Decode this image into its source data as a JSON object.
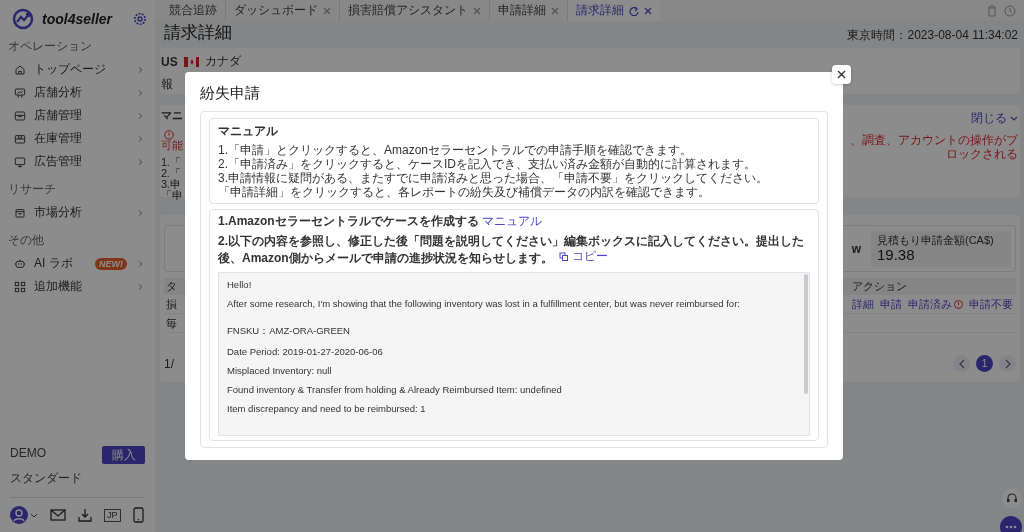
{
  "sidebar": {
    "brand": "tool4seller",
    "sections": [
      {
        "title": "オペレーション",
        "items": [
          {
            "label": "トップページ"
          },
          {
            "label": "店舗分析"
          },
          {
            "label": "店舗管理"
          },
          {
            "label": "在庫管理"
          },
          {
            "label": "広告管理"
          }
        ]
      },
      {
        "title": "リサーチ",
        "items": [
          {
            "label": "市場分析"
          }
        ]
      },
      {
        "title": "その他",
        "items": [
          {
            "label": "AI ラボ",
            "badge": "NEW!"
          },
          {
            "label": "追加機能"
          }
        ]
      }
    ],
    "account": {
      "name": "DEMO",
      "plan": "スタンダード",
      "buy_button": "購入",
      "language": "JP"
    }
  },
  "tabs": [
    {
      "label": "競合追跡",
      "selected": false,
      "closable": false
    },
    {
      "label": "ダッシュボード",
      "selected": false,
      "closable": true
    },
    {
      "label": "損害賠償アシスタント",
      "selected": false,
      "closable": true
    },
    {
      "label": "申請詳細",
      "selected": false,
      "closable": true
    },
    {
      "label": "請求詳細",
      "selected": true,
      "closable": true
    }
  ],
  "page": {
    "title": "請求詳細",
    "time": "東京時間：2023-08-04 11:34:02",
    "marketplace": {
      "code": "US",
      "country": "カナダ",
      "label_fragment": "報"
    },
    "manual_panel": {
      "title_fragment": "マニ",
      "collapse": "閉じる",
      "warning_fragment": "可能",
      "warning_right": "、調査、アカウントの操作がブロックされる",
      "line_fragments": [
        "1.「",
        "2.「",
        "3.申",
        "「申"
      ]
    },
    "summary": {
      "stat_fragment": "w",
      "estimate_label": "見積もり申請金額(CA$)",
      "estimate_value": "19.38"
    },
    "table": {
      "header_fragment": "タ",
      "action_header": "アクション",
      "row_fragments": [
        "損",
        "毎"
      ],
      "actions": [
        {
          "label": "詳細",
          "info": false
        },
        {
          "label": "申請",
          "info": false
        },
        {
          "label": "申請済み",
          "info": true
        },
        {
          "label": "申請不要",
          "info": false
        }
      ]
    },
    "pagination": {
      "total_fragment": "1/",
      "pages": [
        {
          "label": "1",
          "selected": true
        }
      ]
    }
  },
  "modal": {
    "title": "紛失申請",
    "manual": {
      "title": "マニュアル",
      "lines": [
        "1.「申請」とクリックすると、Amazonセラーセントラルでの申請手順を確認できます。",
        "2.「申請済み」をクリックすると、ケースIDを記入でき、支払い済み金額が自動的に計算されます。",
        "3.申請情報に疑問がある、またすでに申請済みと思った場合、「申請不要」をクリックしてください。",
        "「申請詳細」をクリックすると、各レポートの紛失及び補償データの内訳を確認できます。"
      ]
    },
    "step1": {
      "text": "1.Amazonセラーセントラルでケースを作成する",
      "link": "マニュアル"
    },
    "step2": {
      "text": "2.以下の内容を参照し、修正した後「問題を説明してください」編集ボックスに記入してください。提出した後、Amazon側からメールで申請の進捗状況を知らせします。",
      "copy": "コピー"
    },
    "message": [
      "Hello!",
      "After some research, I'm showing that the following inventory was lost in a fulfillment center, but was never reimbursed for:",
      "FNSKU：AMZ-ORA-GREEN",
      "Date Period: 2019-01-27-2020-06-06",
      "Misplaced Inventory: null",
      "Found inventory & Transfer from holding & Already Reimbursed Item: undefined",
      "Item discrepancy and need to be reimbursed: 1"
    ]
  }
}
